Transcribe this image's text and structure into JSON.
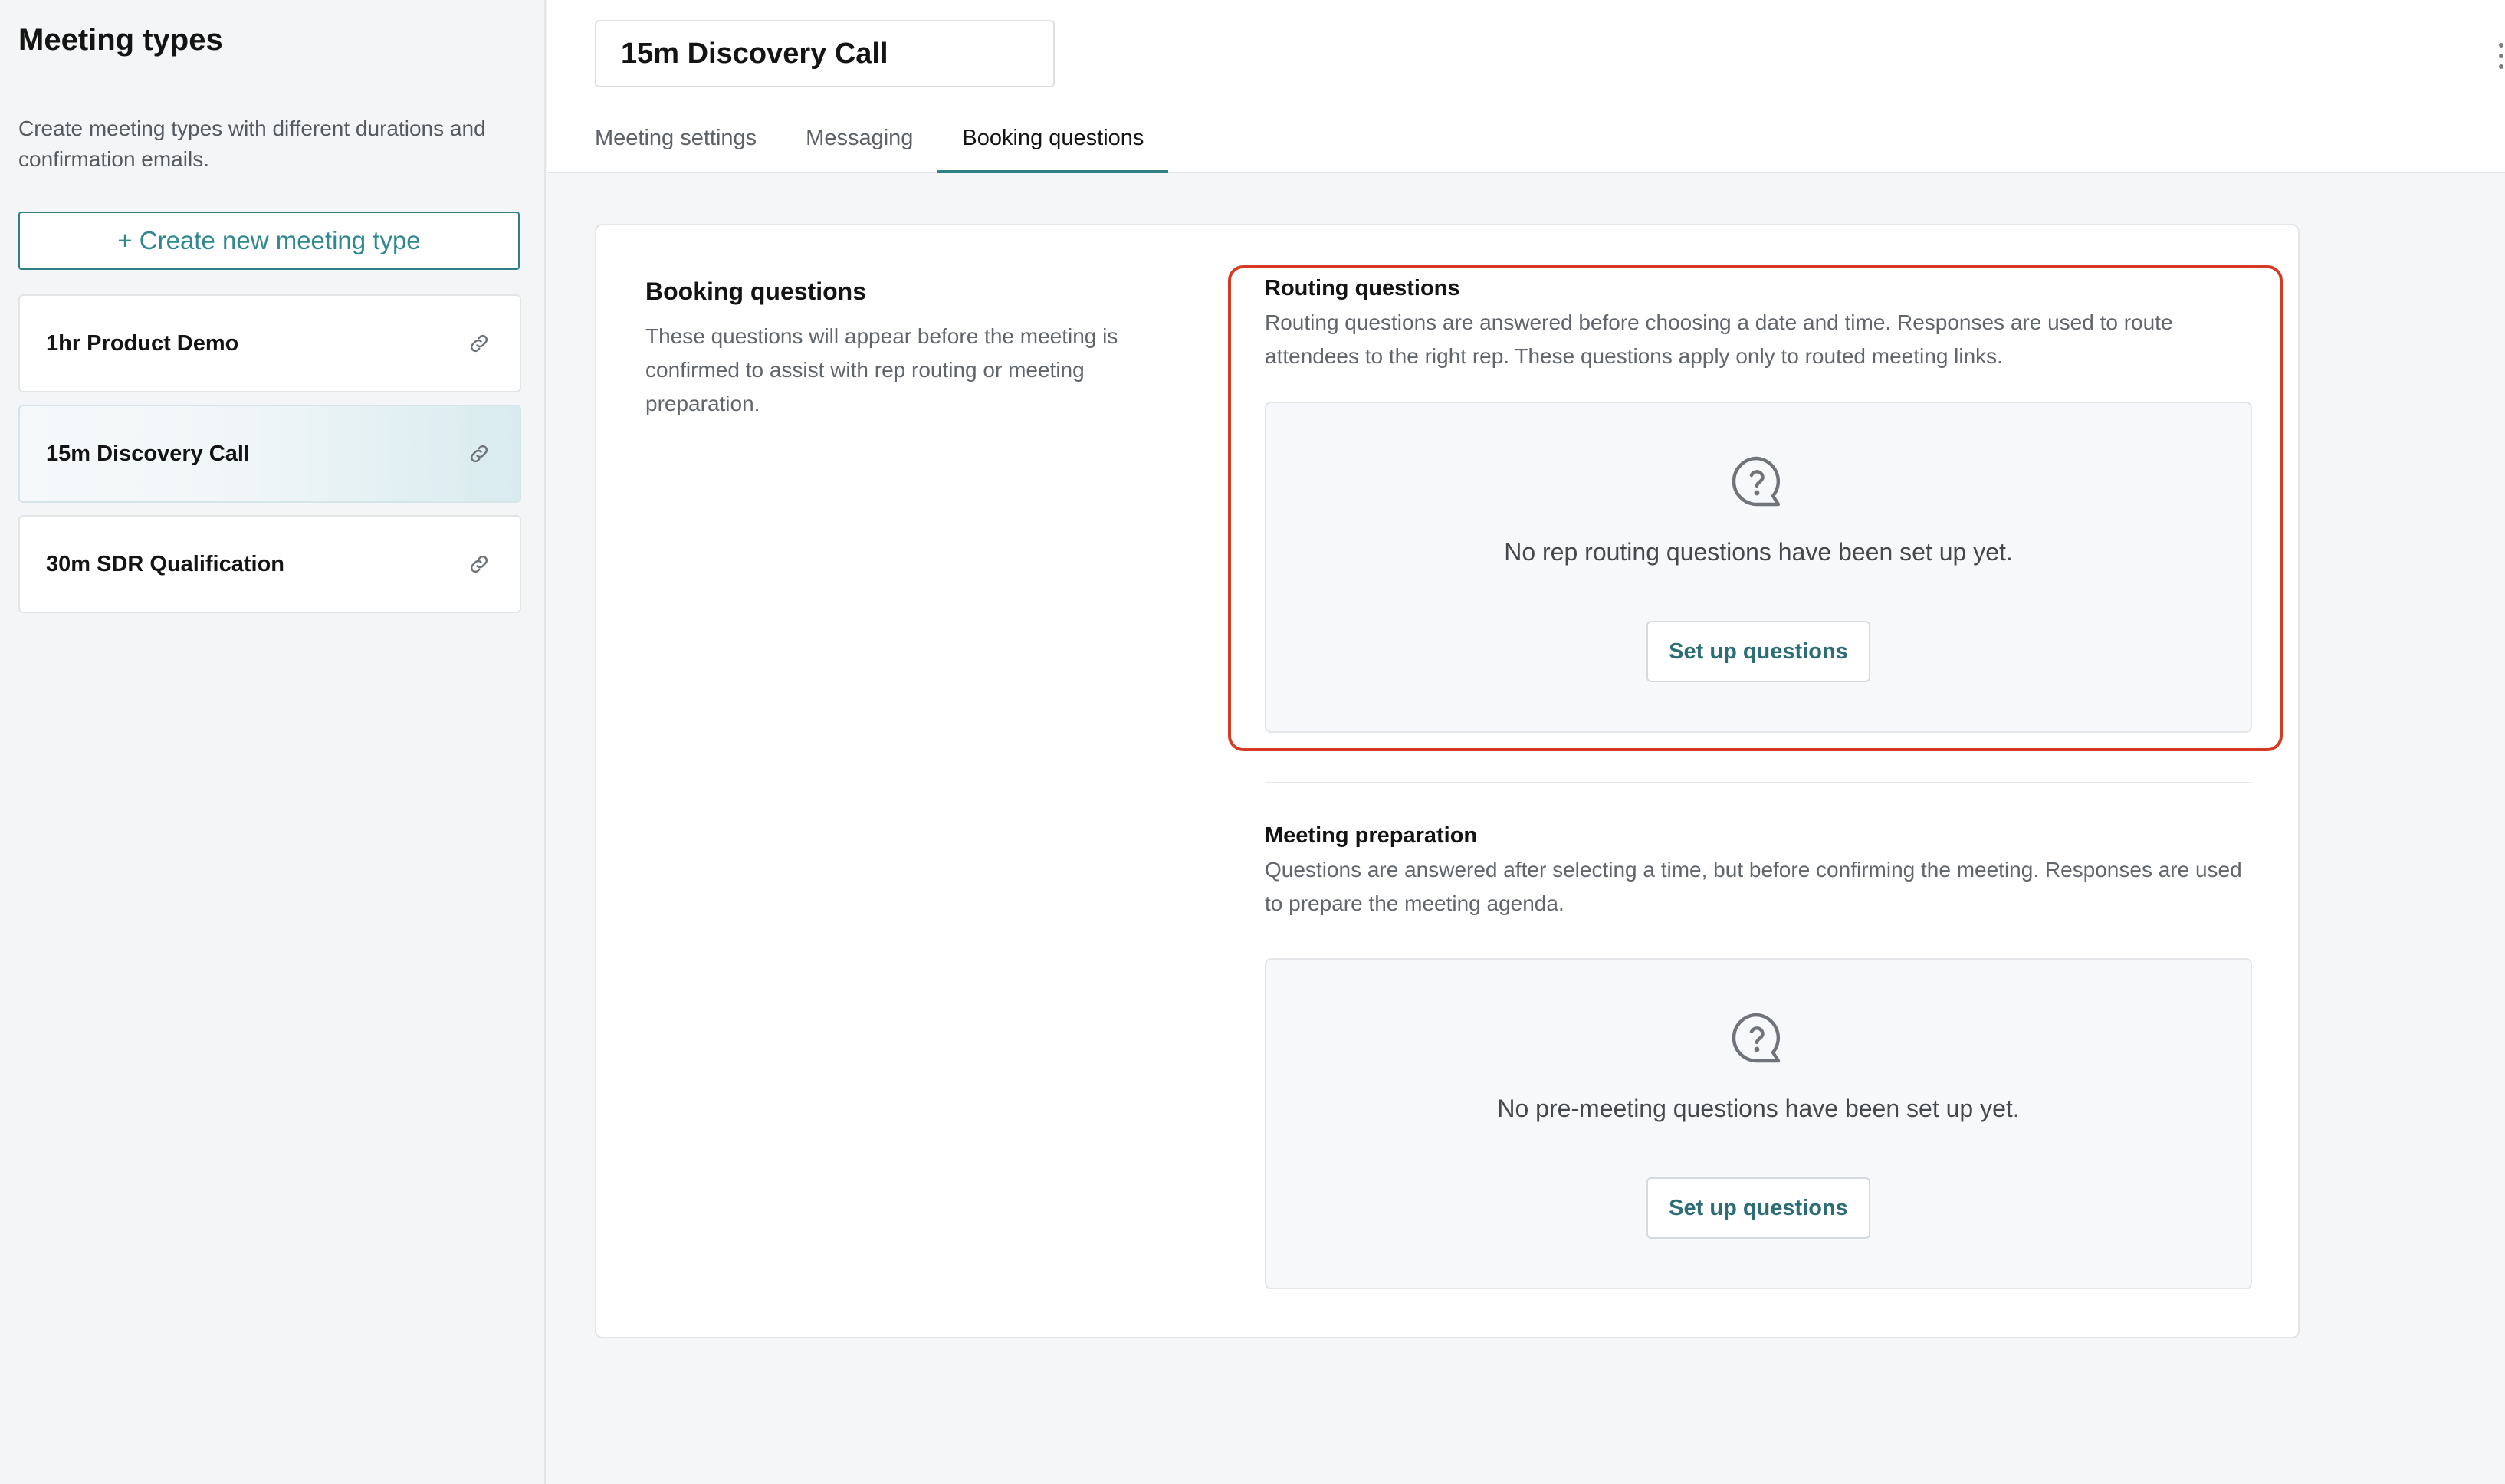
{
  "sidebar": {
    "title": "Meeting types",
    "description": "Create meeting types with different durations and confirmation emails.",
    "create_button_label": "+ Create new meeting type",
    "items": [
      {
        "label": "1hr Product Demo",
        "icon": "link-icon"
      },
      {
        "label": "15m Discovery Call",
        "icon": "link-icon",
        "active": true
      },
      {
        "label": "30m SDR Qualification",
        "icon": "link-icon"
      }
    ]
  },
  "header": {
    "meeting_name_value": "15m Discovery Call",
    "tabs": [
      {
        "label": "Meeting settings"
      },
      {
        "label": "Messaging"
      },
      {
        "label": "Booking questions",
        "active": true
      }
    ]
  },
  "main": {
    "section_title": "Booking questions",
    "section_description": "These questions will appear before the meeting is confirmed to assist with rep routing or meeting preparation.",
    "routing": {
      "title": "Routing questions",
      "description": "Routing questions are answered before choosing a date and time. Responses are used to route attendees to the right rep. These questions apply only to routed meeting links.",
      "empty_text": "No rep routing questions have been set up yet.",
      "button_label": "Set up questions",
      "icon": "question-bubble-icon"
    },
    "preparation": {
      "title": "Meeting preparation",
      "description": "Questions are answered after selecting a time, but before confirming the meeting. Responses are used to prepare the meeting agenda.",
      "empty_text": "No pre-meeting questions have been set up yet.",
      "button_label": "Set up questions",
      "icon": "question-bubble-icon"
    }
  },
  "colors": {
    "accent": "#2f7f86",
    "highlight": "#d63a22"
  }
}
